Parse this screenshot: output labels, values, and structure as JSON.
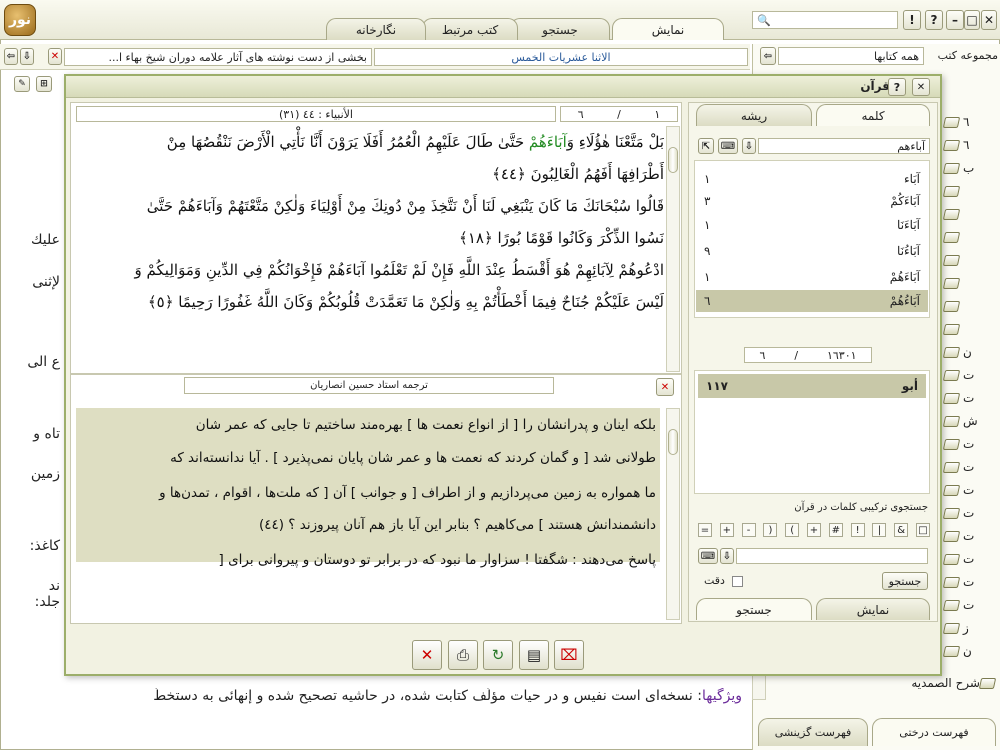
{
  "top_tabs": [
    {
      "label": "نمایش",
      "active": true
    },
    {
      "label": "جستجو",
      "active": false
    },
    {
      "label": "كتب مرتبط",
      "active": false
    },
    {
      "label": "نگارخانه",
      "active": false
    }
  ],
  "window_buttons": {
    "close": "✕",
    "max": "□",
    "min": "–",
    "help": "?",
    "alert": "!"
  },
  "right_panel": {
    "collection_label": "مجموعه كتب",
    "collection_value": "همه كتابها",
    "tree_numbers": [
      "٦",
      "٦",
      "ب",
      "",
      "",
      "",
      "",
      "",
      "",
      "",
      "ن",
      "ت",
      "ت",
      "ش",
      "ت",
      "ت",
      "ت",
      "ت",
      "ت",
      "ت",
      "ت",
      "ت",
      "ز",
      "ن"
    ],
    "last_item": "شرح الصمدیه",
    "bottom_tabs": [
      "فهرست درختی",
      "فهرست گزینشی"
    ]
  },
  "book_bar": {
    "title": "الاثنا عشريات الخمس",
    "subtitle": "بخشی از دست نوشته های آثار علامه دوران شیخ بهاء ا..."
  },
  "background_text": {
    "lines": [
      "عليك",
      "لإثنى",
      "ع الى",
      "تاه و",
      "زمين",
      "كاغذ:",
      "ند جلد:"
    ],
    "bottom_label": "ویژگیها",
    "bottom_line": ": نسخه‌ای است نفیس و در حیات مؤلّف كتابت شده، در حاشیه تصحیح شده و إنهائی به دستخطّ"
  },
  "quran_window": {
    "title": "قرآن",
    "help": "?",
    "verse_ref": "(٣١) الأنبياء : ٤٤",
    "page_num": "١",
    "of_num": "٦",
    "verses": [
      {
        "parts": [
          {
            "t": "بَلْ مَتَّعْنَا هٰؤُلَاءِ وَ",
            "c": "#111"
          },
          {
            "t": "آبَاءَهُمْ",
            "c": "#228b22"
          },
          {
            "t": " حَتَّىٰ طَالَ عَلَيْهِمُ الْعُمُرُ أَفَلَا يَرَوْنَ أَنَّا نَأْتِي الْأَرْضَ نَنْقُصُهَا مِنْ",
            "c": "#111"
          }
        ]
      },
      {
        "parts": [
          {
            "t": "أَطْرَافِهَا أَفَهُمُ الْغَالِبُونَ ﴿٤٤﴾",
            "c": "#111"
          }
        ]
      },
      {
        "parts": [
          {
            "t": "قَالُوا سُبْحَانَكَ مَا كَانَ يَنْبَغِي لَنَا أَنْ نَتَّخِذَ مِنْ دُونِكَ مِنْ أَوْلِيَاءَ وَلٰكِنْ مَتَّعْتَهُمْ وَآبَاءَهُمْ حَتَّىٰ",
            "c": "#111"
          }
        ]
      },
      {
        "parts": [
          {
            "t": "نَسُوا الذِّكْرَ وَكَانُوا قَوْمًا بُورًا ﴿١٨﴾",
            "c": "#111"
          }
        ]
      },
      {
        "parts": [
          {
            "t": "ادْعُوهُمْ لِآبَائِهِمْ هُوَ أَقْسَطُ عِنْدَ اللَّهِ فَإِنْ لَمْ تَعْلَمُوا آبَاءَهُمْ فَإِخْوَانُكُمْ فِي الدِّينِ وَمَوَالِيكُمْ وَ",
            "c": "#111"
          }
        ]
      },
      {
        "parts": [
          {
            "t": "لَيْسَ عَلَيْكُمْ جُنَاحٌ فِيمَا أَخْطَأْتُمْ بِهِ وَلٰكِنْ مَا تَعَمَّدَتْ قُلُوبُكُمْ وَكَانَ اللَّهُ غَفُورًا رَحِيمًا ﴿٥﴾",
            "c": "#111"
          }
        ]
      }
    ],
    "translation_title": "ترجمه استاد حسین انصاریان",
    "translation_lines": [
      "بلكه اینان و پدرانشان را [ از انواع نعمت ها ] بهره‌مند ساختیم تا جایی كه عمر شان",
      "طولانی شد [ و گمان كردند كه نعمت ها و عمر شان پایان نمی‌پذیرد ] . آیا ندانسته‌اند كه",
      "ما همواره به زمین می‌پردازیم و از اطراف [ و جوانب ] آن [ كه ملت‌ها ، اقوام ، تمدن‌ها و",
      "دانشمندانش هستند ] می‌كاهیم ؟ بنابر این آیا باز هم آنان پیروزند ؟ (٤٤)",
      "پاسخ می‌دهند : شگفتا ! سزاوار ما نبود كه در برابر تو دوستان و پیروانی برای ["
    ],
    "side_tabs": [
      "كلمه",
      "ریشه"
    ],
    "search_word": "آباءهم",
    "words": [
      {
        "w": "آبَاء",
        "n": "١"
      },
      {
        "w": "آبَاءَكُمْ",
        "n": "٣"
      },
      {
        "w": "آبَاءَنَا",
        "n": "١"
      },
      {
        "w": "آبَاءُنَا",
        "n": "٩"
      },
      {
        "w": "آبَاءَهُمْ",
        "n": "١"
      },
      {
        "w": "آبَاءُهُمْ",
        "n": "٦"
      }
    ],
    "count_total": "١٦٣٠١",
    "count_num": "٦",
    "result_word": "أبو",
    "result_num": "١١٧",
    "combo_label": "جستجوی تركیبی كلمات در قرآن",
    "symbols": [
      "□",
      "&",
      "|",
      "!",
      "#",
      "+",
      "(",
      ")",
      "-",
      "+",
      "="
    ],
    "exact_label": "دقت",
    "search_button": "جستجو",
    "bottom_tabs": [
      "نمایش",
      "جستجو"
    ]
  }
}
